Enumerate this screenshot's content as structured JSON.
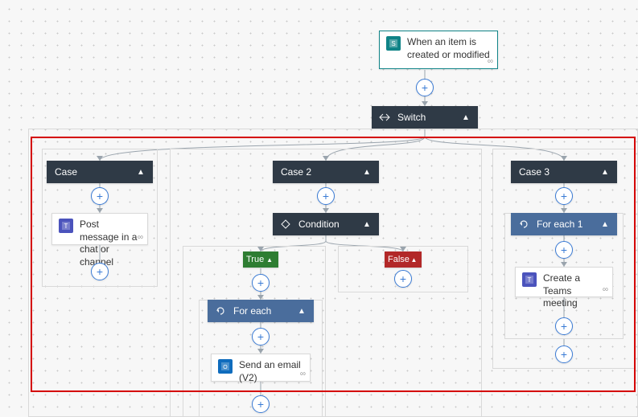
{
  "trigger": {
    "label": "When an item is created or modified"
  },
  "switch": {
    "label": "Switch"
  },
  "cases": {
    "c1": {
      "label": "Case",
      "action": {
        "label": "Post message in a chat or channel"
      }
    },
    "c2": {
      "label": "Case 2",
      "condition": {
        "label": "Condition"
      },
      "trueBranch": {
        "label": "True",
        "foreach": {
          "label": "For each"
        },
        "action": {
          "label": "Send an email (V2)"
        }
      },
      "falseBranch": {
        "label": "False"
      }
    },
    "c3": {
      "label": "Case 3",
      "foreach": {
        "label": "For each 1"
      },
      "action": {
        "label": "Create a Teams meeting"
      }
    }
  },
  "colors": {
    "sharepoint": "#0f8387",
    "teams": "#4b53bc",
    "outlook": "#0f6cbd"
  }
}
